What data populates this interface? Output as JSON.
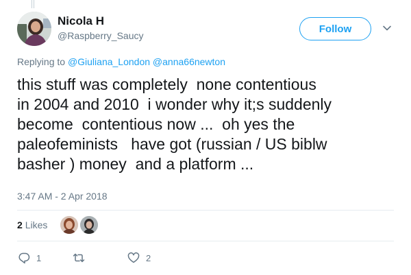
{
  "author": {
    "display_name": "Nicola H",
    "handle": "@Raspberry_Saucy"
  },
  "follow_label": "Follow",
  "reply_prefix": "Replying to",
  "reply_mentions": [
    "@Giuliana_London",
    "@anna66newton"
  ],
  "tweet_text": "this stuff was completely  none contentious\nin 2004 and 2010  i wonder why it;s suddenly\nbecome  contentious now ...  oh yes the\npaleofeminists   have got (russian / US biblw\nbasher ) money  and a platform ...",
  "timestamp": "3:47 AM - 2 Apr 2018",
  "likes": {
    "count": "2",
    "label": "Likes"
  },
  "actions": {
    "reply_count": "1",
    "retweet_count": "",
    "like_count": "2"
  },
  "icons": {
    "caret": "chevron-down-icon",
    "reply": "reply-icon",
    "retweet": "retweet-icon",
    "like": "heart-icon"
  },
  "colors": {
    "accent": "#1da1f2",
    "muted": "#657786",
    "text": "#14171a"
  }
}
